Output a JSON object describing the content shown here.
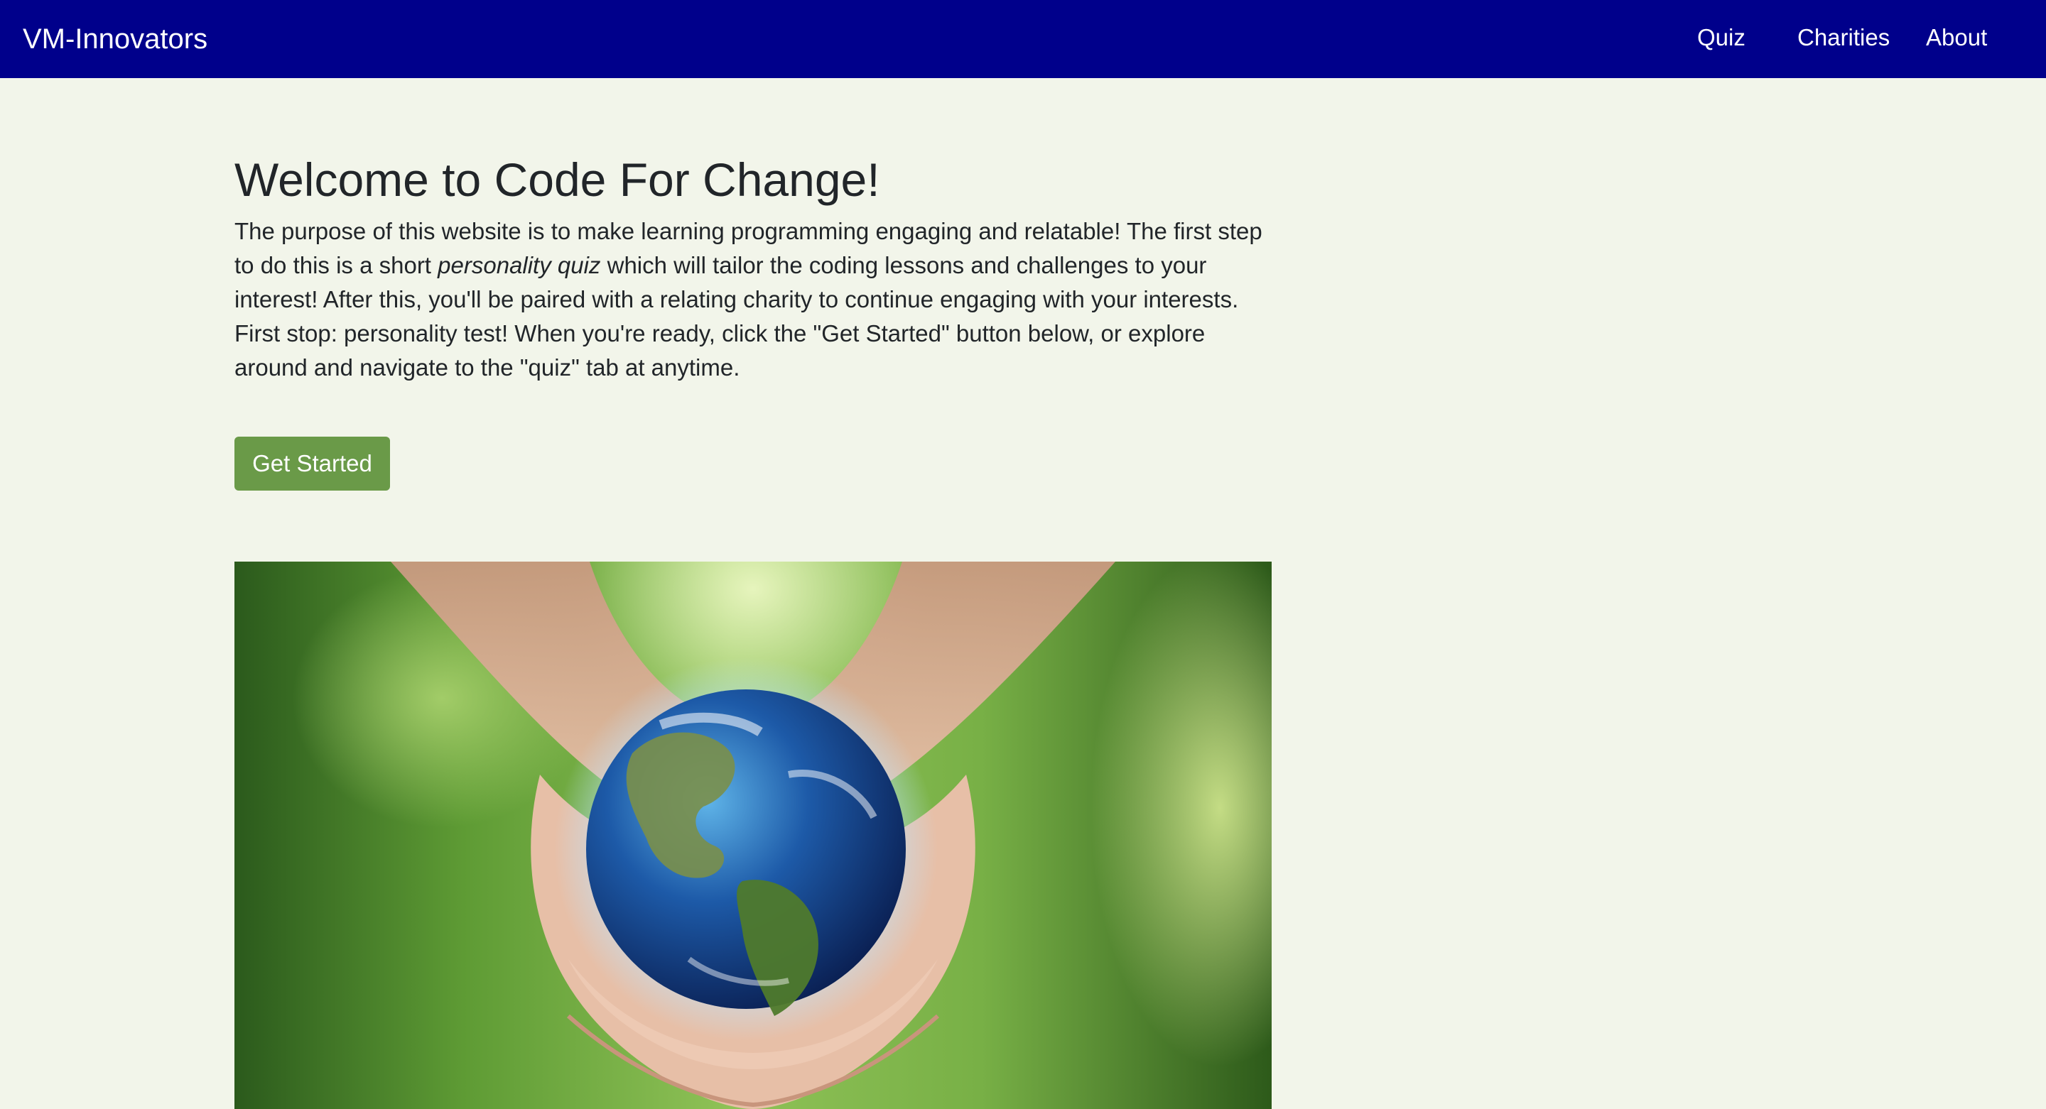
{
  "nav": {
    "brand": "VM-Innovators",
    "links": [
      "Quiz",
      "Charities",
      "About"
    ]
  },
  "main": {
    "title": "Welcome to Code For Change!",
    "intro_part1": "The purpose of this website is to make learning programming engaging and relatable! The first step to do this is a short ",
    "intro_emphasis": "personality quiz",
    "intro_part2": " which will tailor the coding lessons and challenges to your interest! After this, you'll be paired with a relating charity to continue engaging with your interests. First stop: personality test! When you're ready, click the \"Get Started\" button below, or explore around and navigate to the \"quiz\" tab at anytime.",
    "cta_label": "Get Started",
    "hero_image": "hands-holding-earth-image"
  },
  "colors": {
    "navbar_bg": "#00008b",
    "page_bg": "#f2f5ea",
    "button_bg": "#6a9a48",
    "text": "#212529"
  }
}
